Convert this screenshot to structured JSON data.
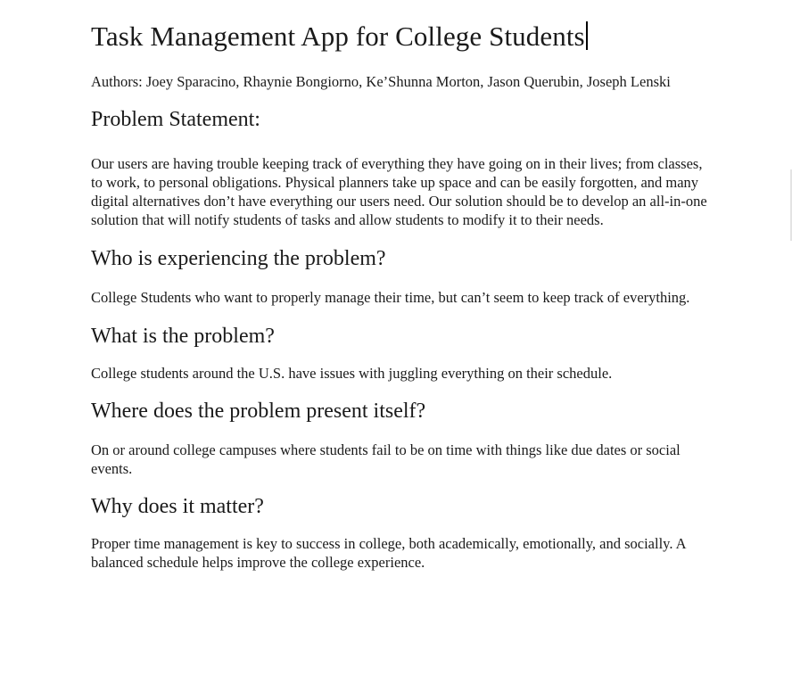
{
  "document": {
    "title": "Task Management App for College Students",
    "authors": "Authors: Joey Sparacino, Rhaynie Bongiorno, Ke’Shunna Morton, Jason Querubin, Joseph Lenski",
    "sections": [
      {
        "heading": "Problem Statement:",
        "body": "Our users are having trouble keeping track of everything they have going on in their lives; from classes, to work, to personal obligations. Physical planners take up space and can be easily forgotten, and many digital alternatives don’t have everything our users need. Our solution should be to develop an all-in-one solution that will notify students of tasks and allow students to modify it to their needs."
      },
      {
        "heading": "Who is experiencing the problem?",
        "body": "College Students who want to properly manage their time, but can’t seem to keep track of everything."
      },
      {
        "heading": "What is the problem?",
        "body": "College students around the U.S. have issues with juggling everything on their schedule."
      },
      {
        "heading": "Where does the problem present itself?",
        "body": "On or around college campuses where students fail to be on time with things like due dates or social events."
      },
      {
        "heading": "Why does it matter?",
        "body": "Proper time management is key to success in college, both academically, emotionally, and socially. A balanced schedule helps improve the college experience."
      }
    ]
  }
}
